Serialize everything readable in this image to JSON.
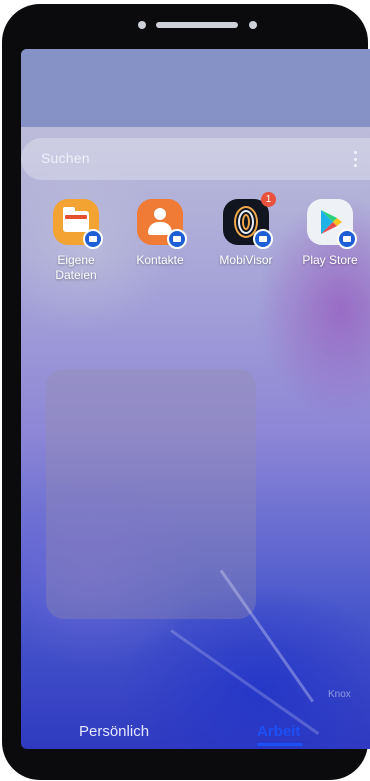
{
  "search": {
    "placeholder": "Suchen"
  },
  "apps": [
    {
      "label_line1": "Eigene",
      "label_line2": "Dateien",
      "icon": "folder-icon",
      "color": "#f3a332"
    },
    {
      "label_line1": "Kontakte",
      "label_line2": "",
      "icon": "contacts-icon",
      "color": "#ef7b36"
    },
    {
      "label_line1": "MobiVisor",
      "label_line2": "",
      "icon": "fingerprint-icon",
      "color": "#10151f",
      "notification_count": "1"
    },
    {
      "label_line1": "Play Store",
      "label_line2": "",
      "icon": "play-store-icon",
      "color": "#eef1f6"
    }
  ],
  "tabs": {
    "personal": "Persönlich",
    "work": "Arbeit",
    "active": "work",
    "active_color": "#1c4ff5"
  },
  "watermark": "Knox"
}
